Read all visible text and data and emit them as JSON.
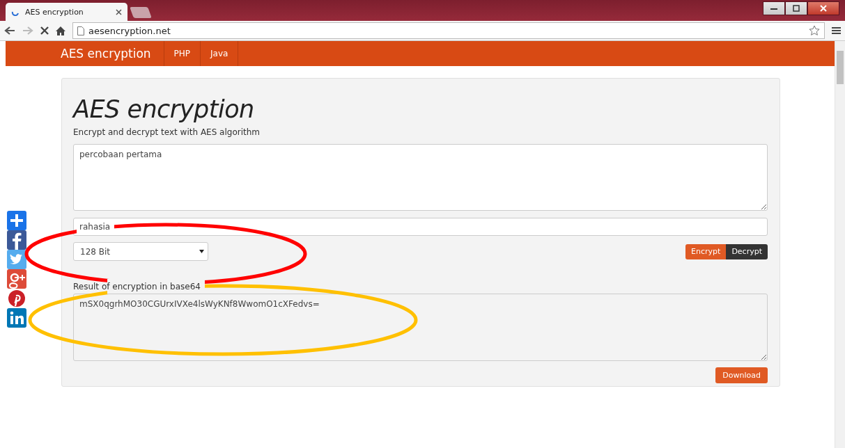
{
  "browser": {
    "tab_title": "AES encryption",
    "address": "aesencryption.net"
  },
  "navbar": {
    "brand": "AES encryption",
    "links": [
      {
        "label": "PHP"
      },
      {
        "label": "Java"
      }
    ]
  },
  "form": {
    "title": "AES encryption",
    "subtitle": "Encrypt and decrypt text with AES algorithm",
    "text_value": "percobaan pertama",
    "key_value": "rahasia",
    "key_size": "128 Bit",
    "buttons": [
      {
        "label": "Encrypt",
        "kind": "primary"
      },
      {
        "label": "Decrypt",
        "kind": "dark"
      }
    ],
    "result_label": "Result of encryption in base64",
    "result_value": "mSX0qgrhMO30CGUrxIVXe4lsWyKNf8WwomO1cXFedvs=",
    "download": "Download"
  },
  "share_buttons": [
    {
      "kind": "add"
    },
    {
      "kind": "facebook"
    },
    {
      "kind": "twitter"
    },
    {
      "kind": "googleplus"
    },
    {
      "kind": "pinterest"
    },
    {
      "kind": "linkedin"
    }
  ],
  "annotations": [
    {
      "kind": "ellipse",
      "color": "#ff0000"
    },
    {
      "kind": "ellipse",
      "color": "#ffc000"
    }
  ]
}
